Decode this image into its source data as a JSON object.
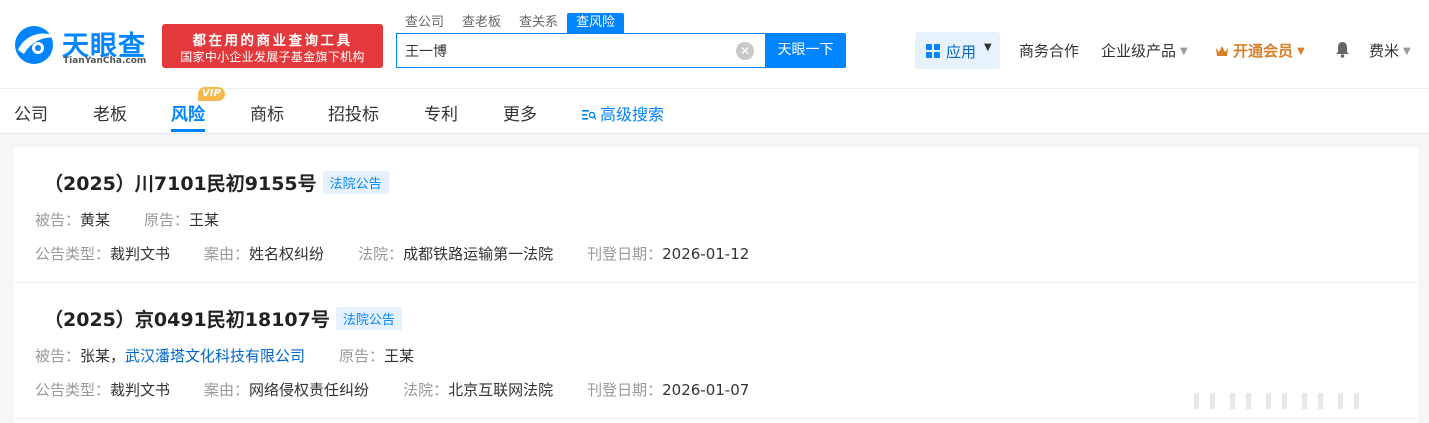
{
  "header": {
    "logo_cn": "天眼查",
    "logo_en": "TianYanCha.com",
    "slogan_line1": "都在用的商业查询工具",
    "slogan_line2": "国家中小企业发展子基金旗下机构",
    "search_tabs": [
      "查公司",
      "查老板",
      "查关系",
      "查风险"
    ],
    "search_value": "王一博",
    "search_button": "天眼一下",
    "apps_label": "应用",
    "nav": {
      "biz_coop": "商务合作",
      "enterprise": "企业级产品",
      "vip": "开通会员",
      "user": "费米"
    },
    "accent_color": "#0084ff"
  },
  "subnav": {
    "items": [
      "公司",
      "老板",
      "风险",
      "商标",
      "招投标",
      "专利",
      "更多"
    ],
    "active": "风险",
    "vip_badge": "VIP",
    "advanced_search": "高级搜索"
  },
  "cases": [
    {
      "title": "（2025）川7101民初9155号",
      "tag": "法院公告",
      "defendant_label": "被告：",
      "defendant": "黄某",
      "defendant_company": "",
      "plaintiff_label": "原告：",
      "plaintiff": "王某",
      "type_label": "公告类型：",
      "type": "裁判文书",
      "cause_label": "案由：",
      "cause": "姓名权纠纷",
      "court_label": "法院：",
      "court": "成都铁路运输第一法院",
      "date_label": "刊登日期：",
      "date": "2026-01-12"
    },
    {
      "title": "（2025）京0491民初18107号",
      "tag": "法院公告",
      "defendant_label": "被告：",
      "defendant": "张某，",
      "defendant_company": "武汉潘塔文化科技有限公司",
      "plaintiff_label": "原告：",
      "plaintiff": "王某",
      "type_label": "公告类型：",
      "type": "裁判文书",
      "cause_label": "案由：",
      "cause": "网络侵权责任纠纷",
      "court_label": "法院：",
      "court": "北京互联网法院",
      "date_label": "刊登日期：",
      "date": "2026-01-07"
    }
  ]
}
